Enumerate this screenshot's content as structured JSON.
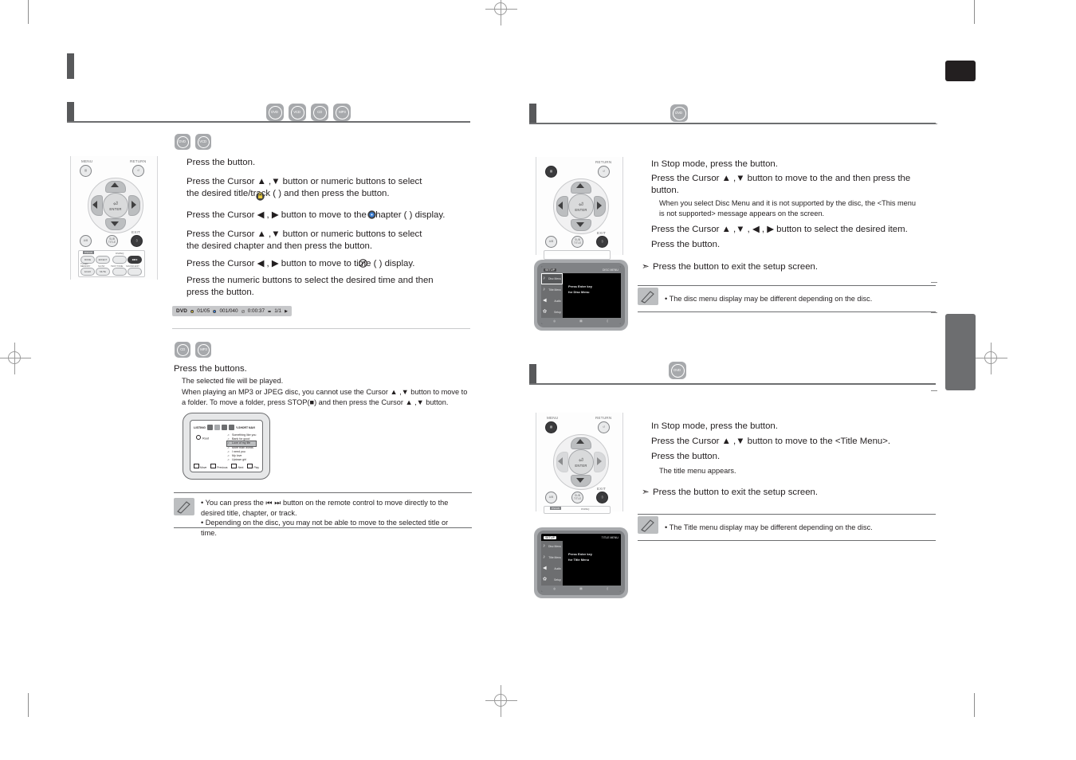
{
  "page": {
    "left_column": {
      "section1": {
        "title": "",
        "badges": [
          "DVD",
          "VCD",
          "CD",
          "MP3"
        ],
        "sub_badges": [
          "DVD",
          "VCD"
        ],
        "steps": [
          "Press the          button.",
          "Press the Cursor ▲ ,▼ button or numeric buttons to select the desired title/track (      )  and then press the               button.",
          "Press the Cursor ◀ , ▶ button to move to the Chapter (    ) display.",
          "Press the Cursor ▲ ,▼ button or numeric buttons to select the desired chapter and then press the             button.",
          "Press the Cursor ◀ , ▶ button to move to time (    )  display.",
          "Press the numeric buttons to select the desired time and then press the             button."
        ],
        "osd_status": {
          "disc": "DVD",
          "title": "01/05",
          "chapter": "001/040",
          "time": "0:00:37",
          "audio": "1/1"
        }
      },
      "section2": {
        "badges": [
          "CD",
          "MP3"
        ],
        "steps": [
          "Press the               buttons."
        ],
        "notes": [
          "The selected file will be played.",
          "When playing an MP3 or JPEG disc, you cannot use the Cursor ▲ ,▼  button to move to a folder. To move a folder, press STOP(■) and then press the Cursor ▲ ,▼ button."
        ],
        "list_screen": {
          "header_label": "LISTING",
          "header_right": "Y-SHORT NAVI",
          "root_label": "Root",
          "tracks": [
            "Something like you",
            "Bank for good",
            "Love of my life",
            "More than words",
            "I need you",
            "My love",
            "Uptown girl"
          ],
          "selected_index": 2,
          "footer": [
            "Move",
            "Previous",
            "Next",
            "Play"
          ]
        }
      },
      "note_box": {
        "lines": [
          "• You can press the ⏮ ⏭ button on the remote control to move directly to the desired title, chapter, or track.",
          "• Depending on the disc, you may not be able to move to the selected title or time."
        ]
      },
      "remote_top": {
        "label_menu": "MENU",
        "label_return": "RETURN",
        "label_enter": "ENTER",
        "label_exit": "EXIT",
        "label_audio": "AUDIO",
        "label_subtitle": "SUB TITLE",
        "group_label": "P.SCAN",
        "label_dspeq": "DSP/EQ",
        "keys": [
          "MODE",
          "EFFECT",
          "SLOW",
          "TEST TONE",
          "SOUND EDIT",
          "INFO",
          "TUNER MEMORY",
          "ECHO",
          "MUTE"
        ]
      }
    },
    "right_column": {
      "section1": {
        "title": "",
        "badges": [
          "DVD"
        ],
        "steps": [
          "In Stop mode, press the            button.",
          "Press the Cursor ▲ ,▼ button to move to the                            and then press the            button.",
          "Press the Cursor ▲ ,▼ , ◀ , ▶ button to select the desired item.",
          "Press the               button."
        ],
        "inline_note": "When you select Disc Menu and it is not supported by the disc, the <This menu is not supported> message appears on the screen.",
        "exit_line": "Press the         button to exit the setup screen.",
        "note_box": "• The disc menu display may be different depending on the disc.",
        "osd": {
          "top_left": "SETUP",
          "top_right": "DISC MENU",
          "items": [
            "Disc Menu",
            "Title Menu",
            "Audio",
            "Setup"
          ],
          "active_index": 0,
          "message": "Press Enter key\nfor Disc Menu"
        }
      },
      "section2": {
        "badges": [
          "DVD"
        ],
        "steps": [
          "In Stop mode, press the          button.",
          "Press the Cursor ▲ ,▼ button to move to the <Title Menu>.",
          "Press the            button."
        ],
        "inline_note": "The title menu appears.",
        "exit_line": "Press the         button to exit the setup screen.",
        "note_box": "• The Title menu display may be different depending on the disc.",
        "osd": {
          "top_left": "SETUP",
          "top_right": "TITLE MENU",
          "items": [
            "Disc Menu",
            "Title Menu",
            "Audio",
            "Setup"
          ],
          "active_index": 1,
          "message": "Press Enter key\nfor Title Menu"
        }
      }
    },
    "colors": {
      "rule": "#6d6e70",
      "bar": "#58595b",
      "badge": "#a7a9ac",
      "tab_dark": "#231f20",
      "tab_grey": "#6d6e70"
    }
  }
}
